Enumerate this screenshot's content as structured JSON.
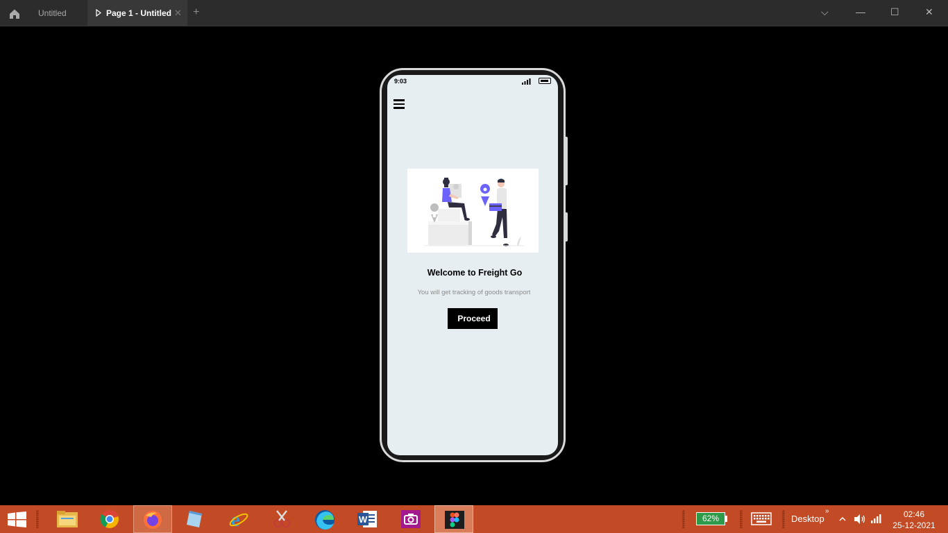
{
  "titlebar": {
    "tabs": [
      {
        "label": "Untitled",
        "active": false
      },
      {
        "label": "Page 1 - Untitled",
        "active": true
      }
    ],
    "close_tab_glyph": "✕",
    "add_tab_glyph": "+",
    "window_controls": {
      "dropdown": "⌵",
      "minimize": "—",
      "maximize": "☐",
      "close": "✕"
    }
  },
  "phone": {
    "status_time": "9:03",
    "welcome_title": "Welcome to Freight Go",
    "subtitle": "You will get tracking of goods transport",
    "proceed_label": "Proceed"
  },
  "taskbar": {
    "apps": [
      "windows-explorer",
      "google-chrome",
      "firefox",
      "notepad",
      "internet-explorer",
      "paint",
      "microsoft-edge",
      "microsoft-word",
      "camera",
      "figma"
    ],
    "battery_percent": "62%",
    "desktop_label": "Desktop",
    "desktop_chevron": "»",
    "time": "02:46",
    "date": "25-12-2021"
  },
  "colors": {
    "taskbar": "#c24a24",
    "screen_bg": "#e6eef2",
    "accent_purple": "#6c63ff",
    "battery_green": "#2e9b4a"
  }
}
